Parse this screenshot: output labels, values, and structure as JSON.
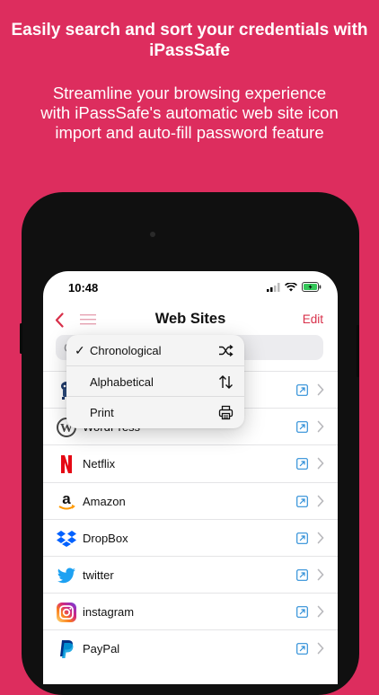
{
  "promo": {
    "headline": "Easily search and sort your credentials with iPassSafe",
    "subline": "Streamline your browsing experience with iPassSafe's automatic web site icon import and auto-fill password feature"
  },
  "status_bar": {
    "time": "10:48"
  },
  "navbar": {
    "title": "Web Sites",
    "edit_label": "Edit",
    "accent_color": "#D8304A"
  },
  "search": {
    "placeholder": "C"
  },
  "sort_menu": {
    "items": [
      {
        "label": "Chronological",
        "checked": true,
        "icon": "shuffle-icon"
      },
      {
        "label": "Alphabetical",
        "checked": false,
        "icon": "sort-arrows-icon"
      },
      {
        "label": "Print",
        "checked": false,
        "icon": "printer-icon"
      }
    ],
    "check_mark": "✓"
  },
  "sites": [
    {
      "name": "",
      "icon": "mascot-logo-icon"
    },
    {
      "name": "WordPress",
      "icon": "wordpress-logo-icon"
    },
    {
      "name": "Netflix",
      "icon": "netflix-logo-icon"
    },
    {
      "name": "Amazon",
      "icon": "amazon-logo-icon"
    },
    {
      "name": "DropBox",
      "icon": "dropbox-logo-icon"
    },
    {
      "name": "twitter",
      "icon": "twitter-logo-icon"
    },
    {
      "name": "instagram",
      "icon": "instagram-logo-icon"
    },
    {
      "name": "PayPal",
      "icon": "paypal-logo-icon"
    }
  ],
  "colors": {
    "background": "#DD2D5E",
    "link_icon": "#2F8FD8"
  }
}
